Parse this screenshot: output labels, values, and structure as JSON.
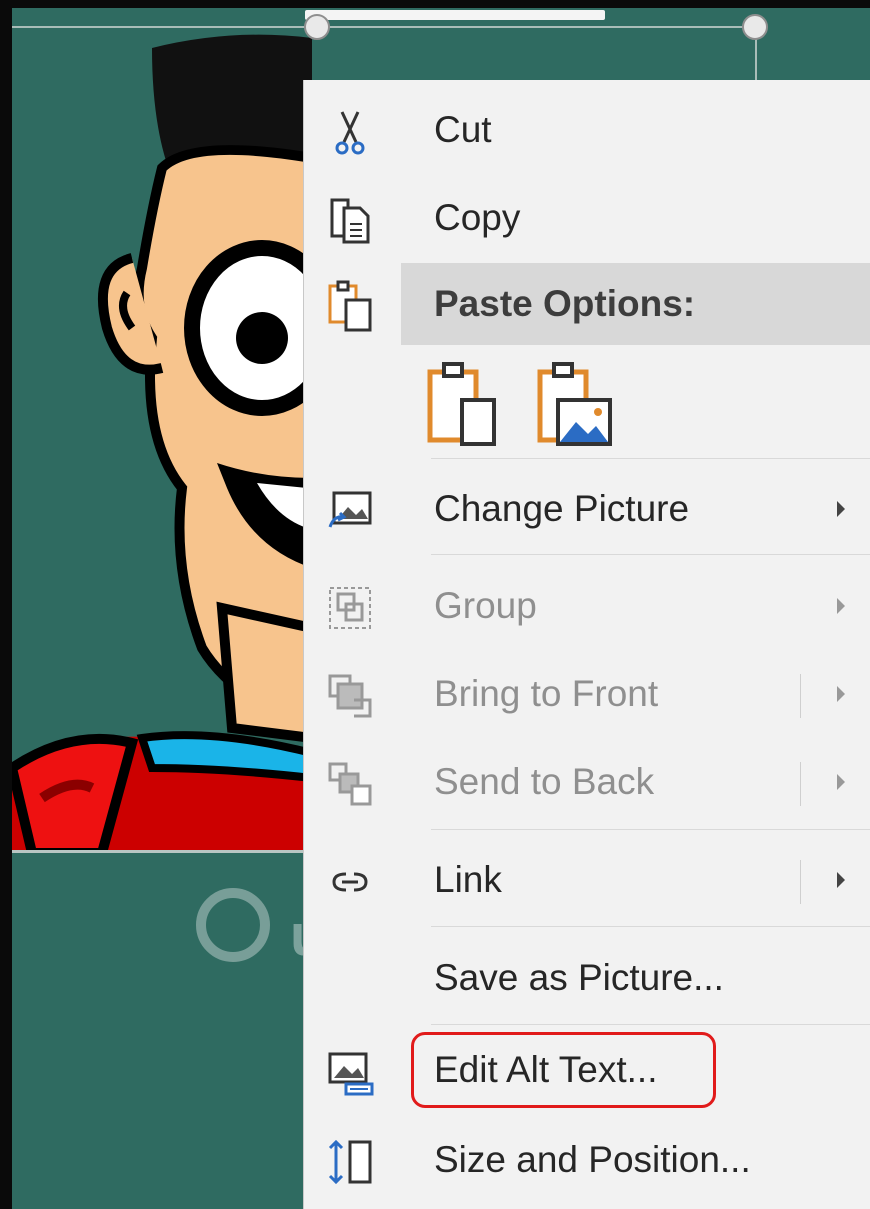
{
  "menu": {
    "cut": "Cut",
    "copy": "Copy",
    "paste_options": "Paste Options:",
    "change_picture": "Change Picture",
    "group": "Group",
    "bring_to_front": "Bring to Front",
    "send_to_back": "Send to Back",
    "link": "Link",
    "save_as_picture": "Save as Picture...",
    "edit_alt_text": "Edit Alt Text...",
    "size_and_position": "Size and Position..."
  },
  "watermark": {
    "text": "uantrimang"
  },
  "colors": {
    "slide_bg": "#2f6b61",
    "menu_bg": "#f2f2f2",
    "highlight_red": "#e11b1b",
    "accent_blue": "#2b6cc4",
    "accent_orange": "#e08a2c"
  }
}
